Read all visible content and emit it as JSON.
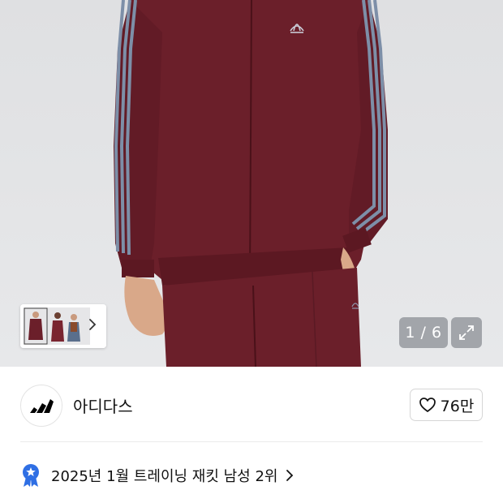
{
  "gallery": {
    "counter_text": "1 / 6",
    "current_index": 1,
    "total_images": 6,
    "thumbnail_icon": "chevron-right-icon",
    "expand_icon": "expand-arrows-icon"
  },
  "brand": {
    "name": "아디다스",
    "logo_icon": "adidas-logo-icon"
  },
  "like": {
    "icon": "heart-outline-icon",
    "count": "76만"
  },
  "ranking": {
    "icon": "star-badge-icon",
    "text": "2025년 1월 트레이닝 재킷 남성 2위",
    "chevron_icon": "chevron-right-icon"
  },
  "colors": {
    "jacket": "#6b1f2a",
    "stripes": "#7d8fa8",
    "badge": "#2f6fe4"
  }
}
